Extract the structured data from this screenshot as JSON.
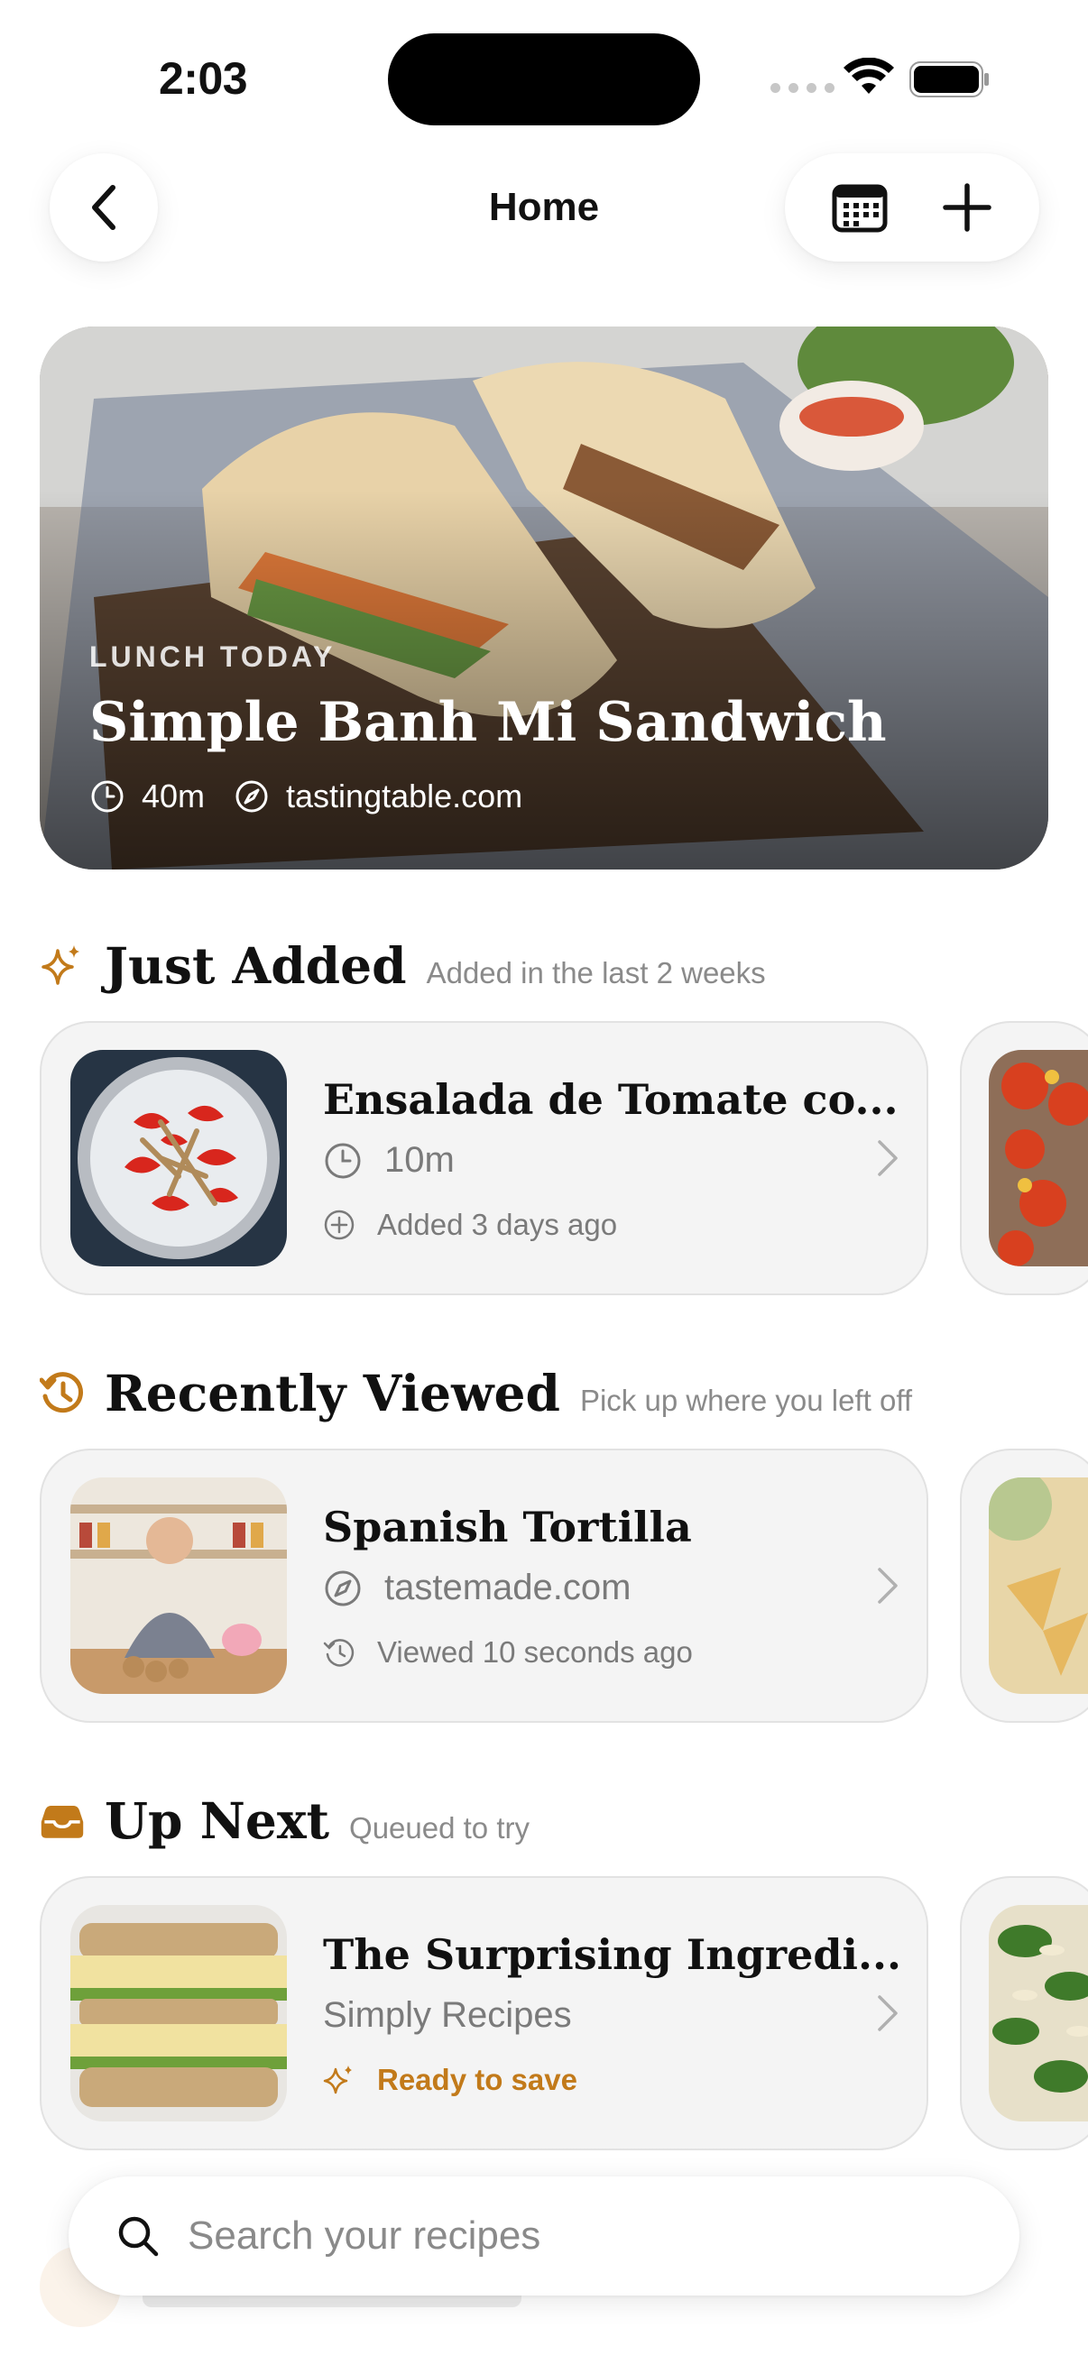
{
  "status_bar": {
    "time": "2:03"
  },
  "nav": {
    "title": "Home"
  },
  "hero": {
    "kicker": "LUNCH TODAY",
    "title": "Simple Banh Mi Sandwich",
    "time": "40m",
    "source": "tastingtable.com"
  },
  "sections": {
    "just_added": {
      "title": "Just Added",
      "subtitle": "Added in the last 2 weeks",
      "card": {
        "title": "Ensalada de Tomate co...",
        "line2": "10m",
        "line3": "Added 3 days ago"
      }
    },
    "recently_viewed": {
      "title": "Recently Viewed",
      "subtitle": "Pick up where you left off",
      "card": {
        "title": "Spanish Tortilla",
        "line2": "tastemade.com",
        "line3": "Viewed 10 seconds ago"
      }
    },
    "up_next": {
      "title": "Up Next",
      "subtitle": "Queued to try",
      "card": {
        "title": "The Surprising Ingredi...",
        "line2": "Simply Recipes",
        "line3": "Ready to save"
      }
    }
  },
  "search": {
    "placeholder": "Search your recipes"
  },
  "colors": {
    "accent": "#C27A1A",
    "card_bg": "#F4F4F4",
    "muted": "#7A7A7A"
  }
}
